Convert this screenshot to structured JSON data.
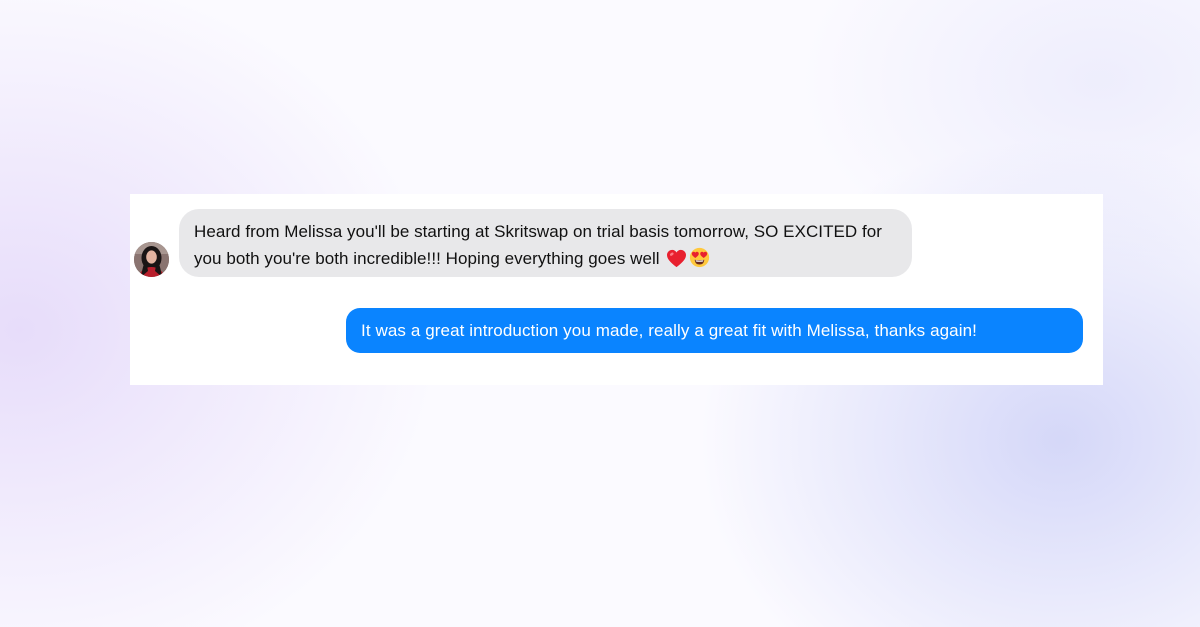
{
  "conversation": {
    "incoming": {
      "text": "Heard from Melissa you'll be starting at Skritswap on trial basis tomorrow, SO EXCITED for you both you're both incredible!!! Hoping everything goes well",
      "emojis": [
        "red-heart-icon",
        "heart-eyes-face-icon"
      ]
    },
    "outgoing": {
      "text": "It was a great introduction you made, really a great fit with Melissa, thanks again!"
    }
  },
  "colors": {
    "incoming_bubble": "#e8e8ea",
    "outgoing_bubble": "#0a84ff",
    "outgoing_text": "#ffffff",
    "card_background": "#ffffff"
  }
}
